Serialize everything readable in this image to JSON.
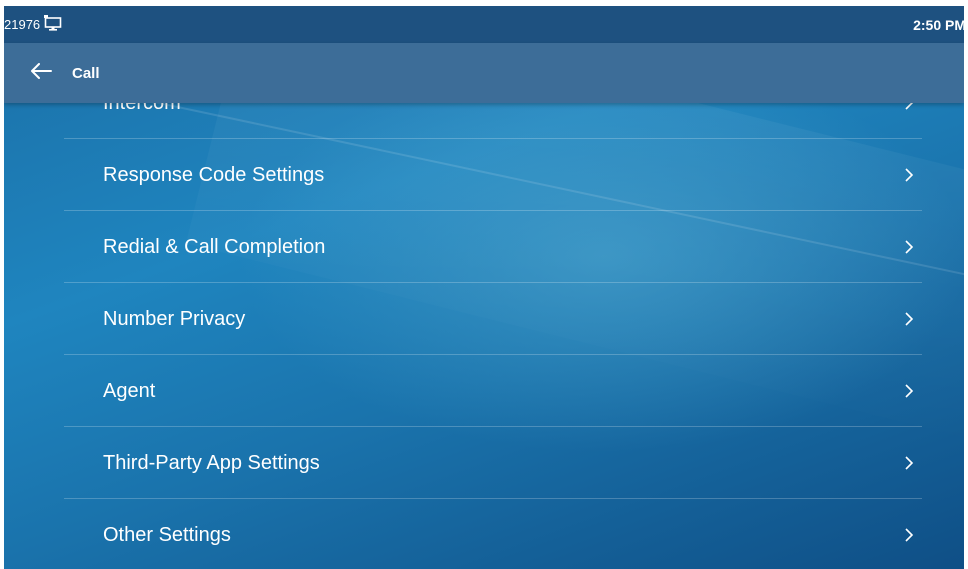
{
  "status_bar": {
    "extension": "21976",
    "network_icon": "network-monitor-icon",
    "time": "2:50 PM"
  },
  "title_bar": {
    "back_icon": "arrow-left-icon",
    "title": "Call"
  },
  "menu": {
    "items": [
      {
        "label": "Intercom"
      },
      {
        "label": "Response Code Settings"
      },
      {
        "label": "Redial & Call Completion"
      },
      {
        "label": "Number Privacy"
      },
      {
        "label": "Agent"
      },
      {
        "label": "Third-Party App Settings"
      },
      {
        "label": "Other Settings"
      }
    ],
    "chevron_icon": "chevron-right-icon"
  },
  "colors": {
    "status_bar": "#1e5180",
    "title_bar": "#3d6d98",
    "background": "#1f85bf",
    "text": "#ffffff"
  }
}
